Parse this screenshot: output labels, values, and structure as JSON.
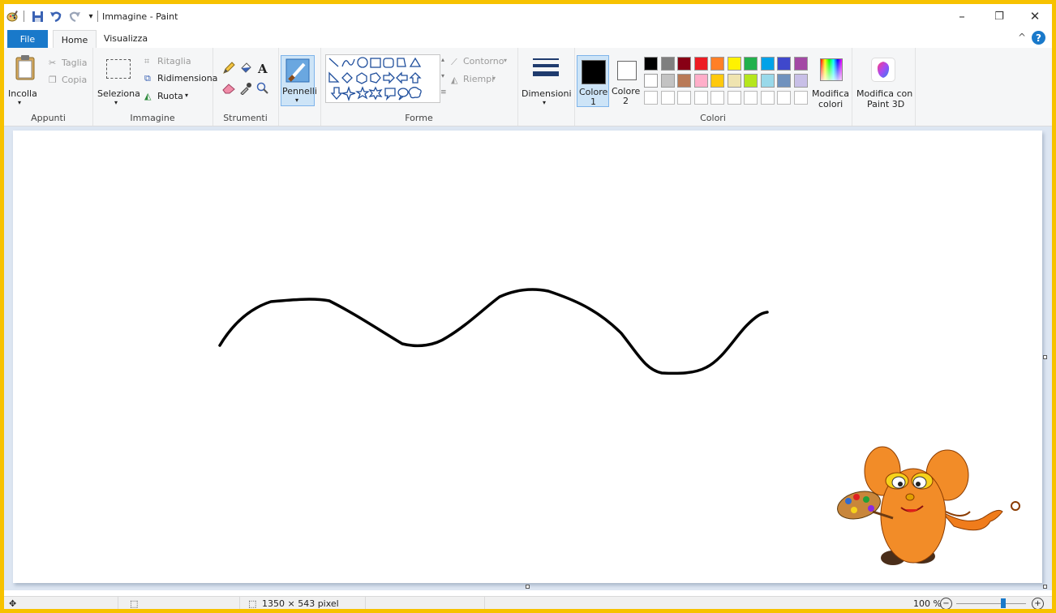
{
  "window": {
    "title": "Immagine - Paint",
    "controls": {
      "minimize": "–",
      "restore": "❐",
      "close": "✕"
    }
  },
  "tabs": {
    "file": "File",
    "home": "Home",
    "view": "Visualizza",
    "collapse": "^",
    "help": "?"
  },
  "ribbon": {
    "clipboard": {
      "paste": "Incolla",
      "cut": "Taglia",
      "copy": "Copia",
      "label": "Appunti"
    },
    "image": {
      "select": "Seleziona",
      "crop": "Ritaglia",
      "resize": "Ridimensiona",
      "rotate": "Ruota",
      "label": "Immagine"
    },
    "tools": {
      "label": "Strumenti"
    },
    "brushes": {
      "label": "Pennelli"
    },
    "shapes": {
      "outline": "Contorno",
      "fill": "Riempi",
      "label": "Forme"
    },
    "size": {
      "label": "Dimensioni"
    },
    "colors": {
      "color1": "Colore",
      "color1_num": "1",
      "color2": "Colore",
      "color2_num": "2",
      "edit_line1": "Modifica",
      "edit_line2": "colori",
      "label": "Colori",
      "color1_value": "#000000",
      "color2_value": "#ffffff",
      "palette_row1": [
        "#000000",
        "#7f7f7f",
        "#880015",
        "#ed1c24",
        "#ff7f27",
        "#fff200",
        "#22b14c",
        "#00a2e8",
        "#3f48cc",
        "#a349a4"
      ],
      "palette_row2": [
        "#ffffff",
        "#c3c3c3",
        "#b97a57",
        "#ffaec9",
        "#ffc90e",
        "#efe4b0",
        "#b5e61d",
        "#99d9ea",
        "#7092be",
        "#c8bfe7"
      ]
    },
    "paint3d": {
      "line1": "Modifica con",
      "line2": "Paint 3D"
    }
  },
  "status": {
    "size": "1350 × 543 pixel",
    "zoom": "100 %",
    "zoom_value": 100
  },
  "icons": [
    "save-icon",
    "undo-icon",
    "redo-icon",
    "scissors-icon",
    "copy-icon",
    "pencil-icon",
    "fill-icon",
    "text-icon",
    "eraser-icon",
    "picker-icon",
    "magnifier-icon",
    "zoom-out-icon",
    "zoom-in-icon"
  ]
}
